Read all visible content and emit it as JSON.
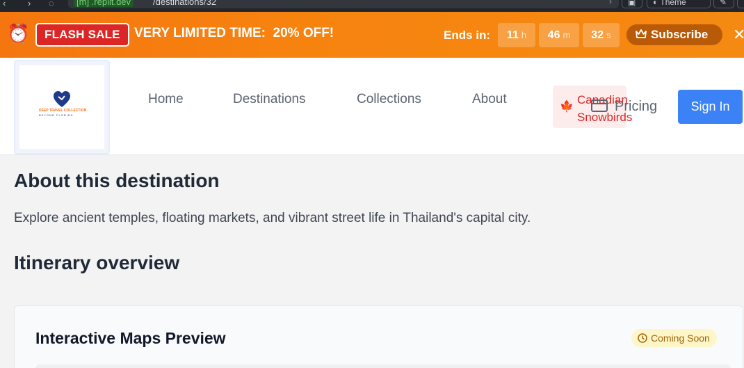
{
  "browser": {
    "host": "[m] .replit.dev",
    "path": "/destinations/32",
    "theme_label": "Theme"
  },
  "banner": {
    "alarm_icon": "alarm-clock-icon",
    "badge": "FLASH SALE",
    "message": "VERY LIMITED TIME:  20% OFF!",
    "ends_label": "Ends in:",
    "timer": {
      "hours": "11",
      "hours_unit": "h",
      "minutes": "46",
      "minutes_unit": "m",
      "seconds": "32",
      "seconds_unit": "s"
    },
    "subscribe_label": "Subscribe",
    "colors": {
      "background": "#f7830f",
      "badge": "#dc2626",
      "subscribe": "#b85a07"
    }
  },
  "header": {
    "logo": {
      "line1": "DEEP TRAVEL COLLECTION",
      "line2": "BEYOND FLORIDA"
    },
    "nav": {
      "home": "Home",
      "destinations": "Destinations",
      "collections": "Collections",
      "about": "About",
      "canadian": "Canadian Snowbirds",
      "pricing": "Pricing"
    },
    "signin_label": "Sign In",
    "colors": {
      "signin": "#3b82f6",
      "canadian_text": "#dc2626"
    }
  },
  "content": {
    "about_heading": "About this destination",
    "about_text": "Explore ancient temples, floating markets, and vibrant street life in Thailand's capital city.",
    "itinerary_heading": "Itinerary overview",
    "maps_card": {
      "title": "Interactive Maps Preview",
      "badge": "Coming Soon"
    }
  }
}
